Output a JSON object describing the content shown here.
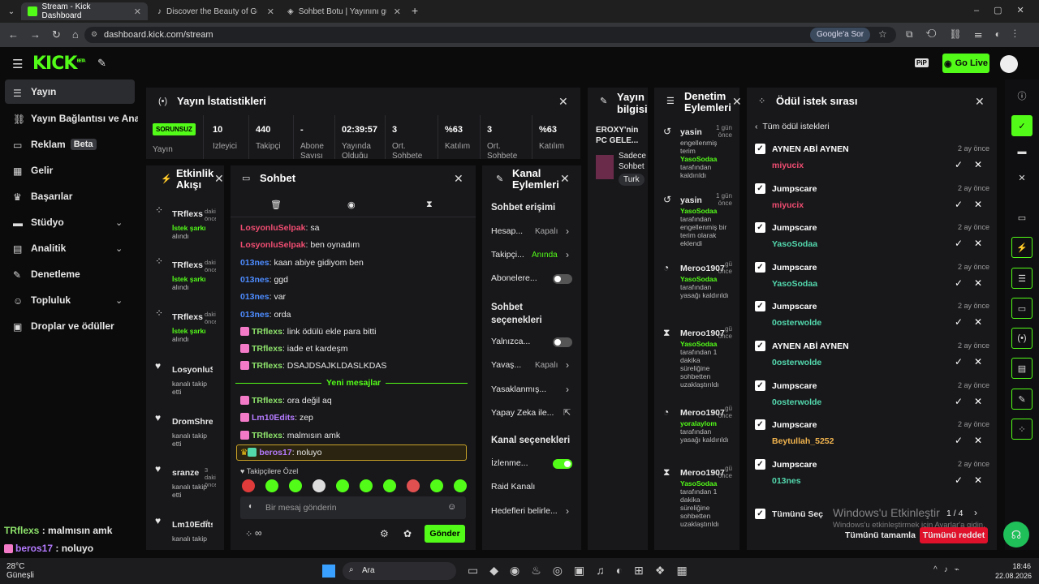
{
  "browser": {
    "tabs": [
      "Stream - Kick Dashboard",
      "Discover the Beauty of Güngör...",
      "Sohbet Botu | Yayınını güçlendir..."
    ],
    "url": "dashboard.kick.com/stream",
    "ask_google": "Google'a Sor"
  },
  "header": {
    "logo": "KICK",
    "logo_beta": "BETA",
    "go_live": "Go Live",
    "pip": "PiP"
  },
  "sidebar": {
    "items": [
      {
        "label": "Yayın",
        "icon": "broadcast-icon"
      },
      {
        "label": "Yayın Bağlantısı ve Anahtarı",
        "icon": "link-icon"
      },
      {
        "label": "Reklam",
        "icon": "ad-icon",
        "badge": "Beta"
      },
      {
        "label": "Gelir",
        "icon": "revenue-icon"
      },
      {
        "label": "Başarılar",
        "icon": "trophy-icon"
      },
      {
        "label": "Stüdyo",
        "icon": "studio-icon"
      },
      {
        "label": "Analitik",
        "icon": "analytics-icon"
      },
      {
        "label": "Denetleme",
        "icon": "moderation-icon"
      },
      {
        "label": "Topluluk",
        "icon": "community-icon"
      },
      {
        "label": "Droplar ve ödüller",
        "icon": "gift-icon"
      }
    ]
  },
  "stats": {
    "title": "Yayın İstatistikleri",
    "status": "SORUNSUZ",
    "status_label": "Yayın",
    "cells": [
      {
        "v": "10",
        "l": "İzleyici"
      },
      {
        "v": "440",
        "l": "Takipçi"
      },
      {
        "v": "-",
        "l": "Abone Sayısı"
      },
      {
        "v": "02:39:57",
        "l": "Yayında Olduğu"
      },
      {
        "v": "3",
        "l": "Ort. Sohbete"
      },
      {
        "v": "%63",
        "l": "Katılım"
      },
      {
        "v": "3",
        "l": "Ort. Sohbete"
      },
      {
        "v": "%63",
        "l": "Katılım"
      }
    ]
  },
  "info": {
    "title": "Yayın bilgisi",
    "stream_title": "EROXY'nin PC GELE...",
    "sub1": "Sadece",
    "sub2": "Sohbet",
    "tag": "Turk"
  },
  "moderation": {
    "title": "Denetim Eylemleri",
    "items": [
      {
        "user": "yasin",
        "time": "1 gün önce",
        "lines": [
          "engellenmiş",
          "terim"
        ],
        "actor": "YasoSodaa",
        "tail": [
          "tarafından",
          "kaldırıldı"
        ]
      },
      {
        "user": "yasin",
        "time": "1 gün önce",
        "lines": [],
        "actor": "YasoSodaa",
        "tail": [
          "tarafından",
          "engellenmiş bir",
          "terim olarak",
          "eklendi"
        ]
      },
      {
        "user": "Meroo1907",
        "time": "gü önce",
        "lines": [],
        "actor": "YasoSodaa",
        "tail": [
          "tarafından",
          "yasağı kaldırıldı"
        ]
      },
      {
        "user": "Meroo1907",
        "time": "gü önce",
        "lines": [],
        "actor": "YasoSodaa",
        "tail": [
          "tarafından 1",
          "dakika",
          "süreliğine",
          "sohbetten",
          "uzaklaştırıldı"
        ]
      },
      {
        "user": "Meroo1907",
        "time": "gü önce",
        "lines": [],
        "actor": "yoralaylom",
        "tail": [
          "tarafından",
          "yasağı kaldırıldı"
        ]
      },
      {
        "user": "Meroo1907",
        "time": "gü önce",
        "lines": [],
        "actor": "YasoSodaa",
        "tail": [
          "tarafından 1",
          "dakika",
          "süreliğine",
          "sohbetten",
          "uzaklaştırıldı"
        ]
      }
    ]
  },
  "activity": {
    "title": "Etkinlik Akışı",
    "items": [
      {
        "user": "TRflexs",
        "meta": "daki önce",
        "act": "İstek şarkı",
        "sub": "alındı"
      },
      {
        "user": "TRflexs",
        "meta": "daki önce",
        "act": "İstek şarkı",
        "sub": "alındı"
      },
      {
        "user": "TRflexs",
        "meta": "daki önce",
        "act": "İstek şarkı",
        "sub": "alındı"
      },
      {
        "user": "LosyonluSe",
        "meta": "",
        "act": "kanalı takip",
        "sub": "etti"
      },
      {
        "user": "DromShrew",
        "meta": "",
        "act": "kanalı takip",
        "sub": "etti"
      },
      {
        "user": "sranze",
        "meta": "3 dakika önce",
        "act": "kanalı takip",
        "sub": "etti"
      },
      {
        "user": "Lm10Edits",
        "meta": "d",
        "act": "kanalı takip",
        "sub": ""
      }
    ]
  },
  "chat": {
    "title": "Sohbet",
    "messages": [
      {
        "u": "LosyonluSelpak",
        "c": "red",
        "t": "sa"
      },
      {
        "u": "LosyonluSelpak",
        "c": "red",
        "t": "ben oynadım"
      },
      {
        "u": "013nes",
        "c": "blue",
        "t": "kaan abiye gidiyom ben"
      },
      {
        "u": "013nes",
        "c": "blue",
        "t": "ggd"
      },
      {
        "u": "013nes",
        "c": "blue",
        "t": "var"
      },
      {
        "u": "013nes",
        "c": "blue",
        "t": "orda"
      },
      {
        "u": "TRflexs",
        "c": "lime",
        "t": "link ödülü ekle para bitti",
        "b": true
      },
      {
        "u": "TRflexs",
        "c": "lime",
        "t": "iade et kardeşm",
        "b": true
      },
      {
        "u": "TRflexs",
        "c": "lime",
        "t": "DSAJDSAJKLDASLKDAS",
        "b": true
      }
    ],
    "new_label": "Yeni mesajlar",
    "new_messages": [
      {
        "u": "TRflexs",
        "c": "lime",
        "t": "ora değil aq",
        "b": true
      },
      {
        "u": "Lm10Edits",
        "c": "purp",
        "t": "zep",
        "b": true
      },
      {
        "u": "TRflexs",
        "c": "lime",
        "t": "malmısın amk",
        "b": true
      }
    ],
    "highlight": {
      "u": "beros17",
      "t": "noluyo"
    },
    "followers_only": "Takipçilere Özel",
    "placeholder": "Bir mesaj gönderin",
    "send": "Gönder",
    "inf": "∞"
  },
  "channel": {
    "title": "Kanal Eylemleri",
    "sec1": "Sohbet erişimi",
    "sec2": "Sohbet seçenekleri",
    "sec3": "Kanal seçenekleri",
    "opts": [
      {
        "l": "Hesap...",
        "v": "Kapalı"
      },
      {
        "l": "Takipçi...",
        "v": "Anında"
      },
      {
        "l": "Abonelere...",
        "v": ""
      },
      {
        "l": "Yalnızca...",
        "v": ""
      },
      {
        "l": "Yavaş...",
        "v": "Kapalı"
      },
      {
        "l": "Yasaklanmış...",
        "v": ""
      },
      {
        "l": "Yapay Zeka ile...",
        "v": ""
      },
      {
        "l": "İzlenme...",
        "v": ""
      },
      {
        "l": "Raid Kanalı",
        "v": ""
      },
      {
        "l": "Hedefleri belirle...",
        "v": ""
      }
    ]
  },
  "rewards": {
    "title": "Ödül istek sırası",
    "back": "Tüm ödül istekleri",
    "time": "2 ay önce",
    "items": [
      {
        "t": "AYNEN ABİ AYNEN",
        "u": "miyucix",
        "c": "red"
      },
      {
        "t": "Jumpscare",
        "u": "miyucix",
        "c": "red"
      },
      {
        "t": "Jumpscare",
        "u": "YasoSodaa",
        "c": "teal"
      },
      {
        "t": "Jumpscare",
        "u": "YasoSodaa",
        "c": "teal"
      },
      {
        "t": "Jumpscare",
        "u": "0osterwolde",
        "c": "teal"
      },
      {
        "t": "AYNEN ABİ AYNEN",
        "u": "0osterwolde",
        "c": "teal"
      },
      {
        "t": "Jumpscare",
        "u": "0osterwolde",
        "c": "teal"
      },
      {
        "t": "Jumpscare",
        "u": "Beytullah_5252",
        "c": "orange"
      },
      {
        "t": "Jumpscare",
        "u": "013nes",
        "c": "teal"
      }
    ],
    "select_all": "Tümünü Seç",
    "page": "1 / 4",
    "complete_all": "Tümünü tamamla",
    "reject_all": "Tümünü reddet"
  },
  "overlay": {
    "l1u": "TRflexs",
    "l1t": "malmısın amk",
    "l2u": "beros17",
    "l2t": "noluyo"
  },
  "watermark": {
    "l1": "Windows'u Etkinleştir",
    "l2": "Windows'u etkinleştirmek için Ayarlar'a gidin."
  },
  "taskbar": {
    "temp": "28°C",
    "weather": "Güneşli",
    "search": "Ara",
    "time": "18:46",
    "date": "22.08.2026"
  },
  "colors": {
    "accent": "#53fc18",
    "reject": "#e0112b"
  }
}
